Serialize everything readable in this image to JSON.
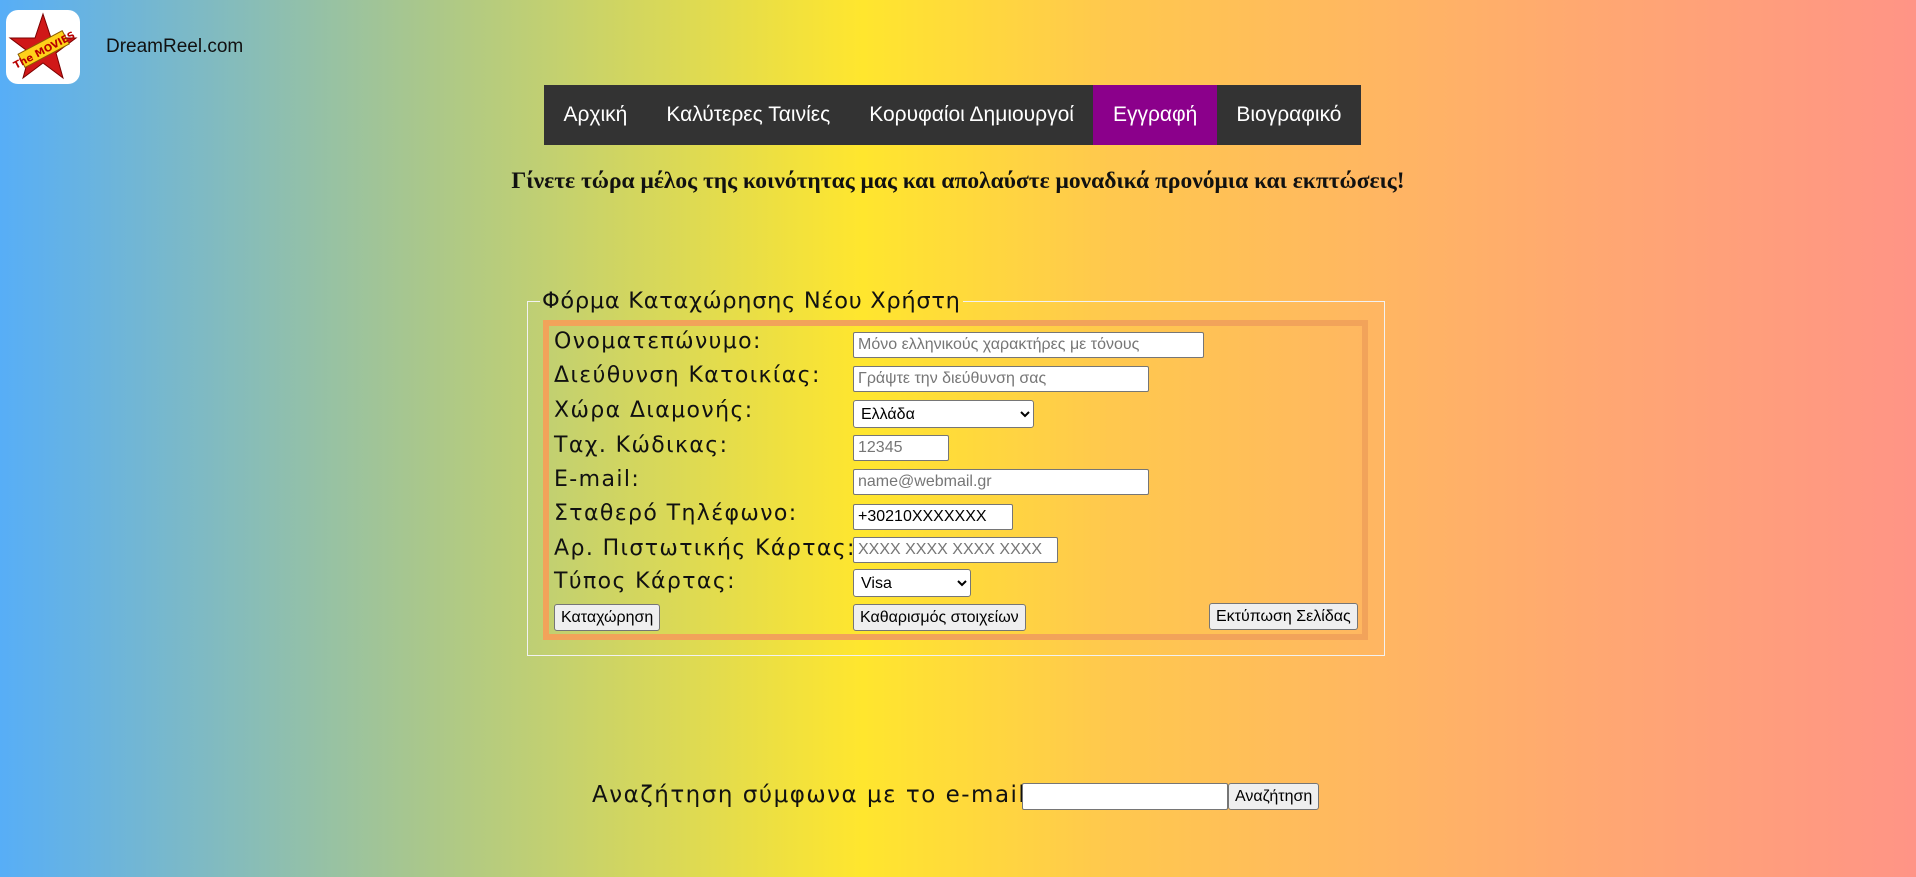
{
  "header": {
    "logo_text": "The MOVIES",
    "site_name": "DreamReel.com"
  },
  "nav": {
    "items": [
      {
        "label": "Αρχική"
      },
      {
        "label": "Καλύτερες Ταινίες"
      },
      {
        "label": "Κορυφαίοι Δημιουργοί"
      },
      {
        "label": "Εγγραφή",
        "active": true
      },
      {
        "label": "Βιογραφικό"
      }
    ],
    "active_color": "#8b008b",
    "bg_color": "#333333"
  },
  "tagline": "Γίνετε τώρα μέλος της κοινότητας μας και απολαύστε μοναδικά προνόμια και εκπτώσεις!",
  "form": {
    "legend": "Φόρμα Καταχώρησης Νέου Χρήστη",
    "fields": {
      "fullname": {
        "label": "Ονοματεπώνυμο:",
        "value": "",
        "placeholder": "Μόνο ελληνικούς χαρακτήρες με τόνους"
      },
      "address": {
        "label": "Διεύθυνση Κατοικίας:",
        "value": "",
        "placeholder": "Γράψτε την διεύθυνση σας"
      },
      "country": {
        "label": "Χώρα Διαμονής:",
        "selected": "Ελλάδα"
      },
      "zip": {
        "label": "Ταχ. Κώδικας:",
        "value": "",
        "placeholder": "12345"
      },
      "email": {
        "label": "E-mail:",
        "value": "",
        "placeholder": "name@webmail.gr"
      },
      "phone": {
        "label": "Σταθερό Τηλέφωνο:",
        "value": "+30210XXXXXXX"
      },
      "card_number": {
        "label": "Αρ. Πιστωτικής Κάρτας:",
        "value": "",
        "placeholder": "XXXX XXXX XXXX XXXX"
      },
      "card_type": {
        "label": "Τύπος Κάρτας:",
        "selected": "Visa"
      }
    },
    "buttons": {
      "submit": "Καταχώρηση",
      "reset": "Καθαρισμός στοιχείων",
      "print": "Εκτύπωση Σελίδας"
    },
    "border_color": "#f2a35a"
  },
  "search": {
    "label": "Αναζήτηση σύμφωνα με το e-mail:",
    "value": "",
    "button": "Αναζήτηση"
  }
}
